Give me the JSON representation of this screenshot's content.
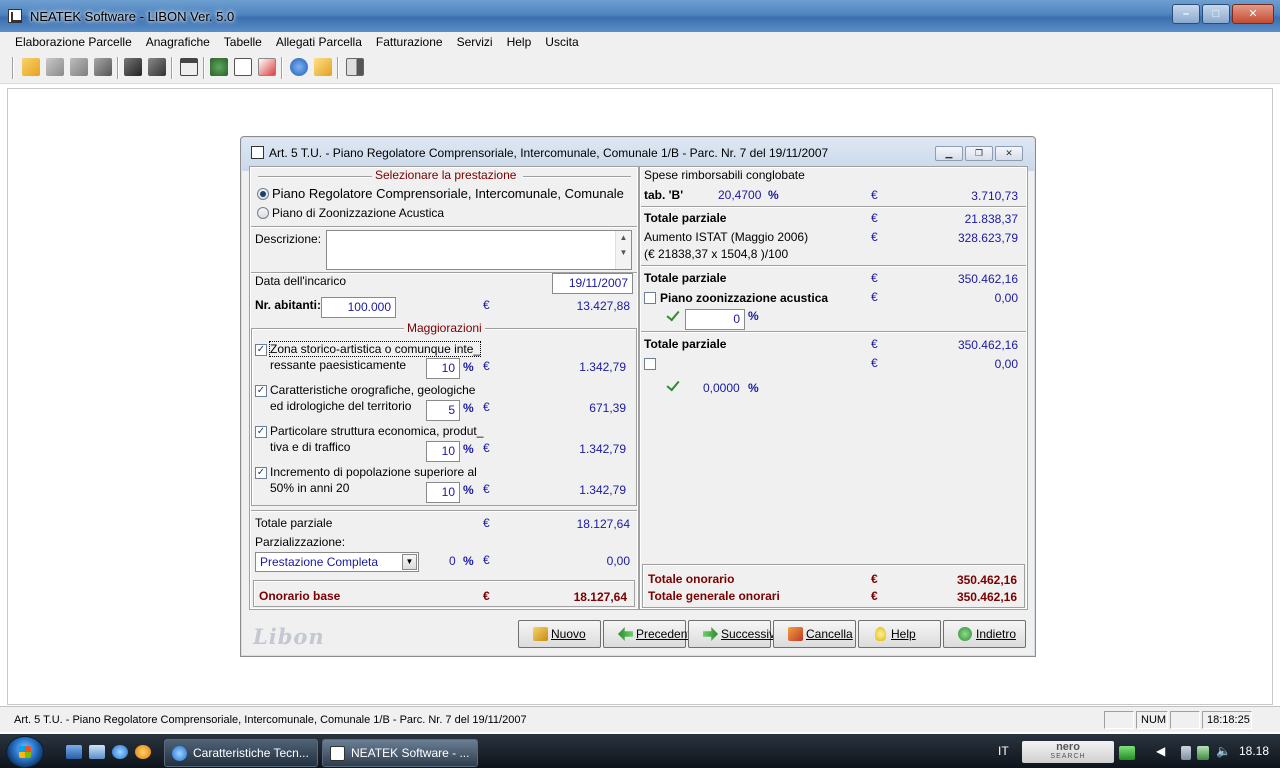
{
  "window": {
    "title": "NEATEK Software  -  LIBON Ver. 5.0"
  },
  "menu": [
    "Elaborazione Parcelle",
    "Anagrafiche",
    "Tabelle",
    "Allegati Parcella",
    "Fatturazione",
    "Servizi",
    "Help",
    "Uscita"
  ],
  "dialog": {
    "title": "Art. 5 T.U. - Piano Regolatore Comprensoriale, Intercomunale, Comunale 1/B - Parc. Nr. 7  del 19/11/2007",
    "left": {
      "select_header": "Selezionare la prestazione",
      "options": [
        {
          "label": "Piano Regolatore Comprensoriale, Intercomunale, Comunale",
          "selected": true
        },
        {
          "label": "Piano di Zoonizzazione Acustica",
          "selected": false
        }
      ],
      "descrizione_label": "Descrizione:",
      "descrizione_value": "",
      "data_label": "Data dell'incarico",
      "data_value": "19/11/2007",
      "abitanti_label": "Nr. abitanti:",
      "abitanti_value": "100.000",
      "abitanti_amount": "13.427,88",
      "maggiorazioni_header": "Maggiorazioni",
      "maggiorazioni": [
        {
          "line1": "Zona storico-artistica o comunque inte_",
          "line2": "ressante paesisticamente",
          "checked": true,
          "pct": "10",
          "amount": "1.342,79"
        },
        {
          "line1": "Caratteristiche orografiche, geologiche",
          "line2": "ed idrologiche del territorio",
          "checked": true,
          "pct": "5",
          "amount": "671,39"
        },
        {
          "line1": "Particolare struttura economica, produt_",
          "line2": "tiva e di traffico",
          "checked": true,
          "pct": "10",
          "amount": "1.342,79"
        },
        {
          "line1": "Incremento di popolazione superiore al",
          "line2": "50% in anni 20",
          "checked": true,
          "pct": "10",
          "amount": "1.342,79"
        }
      ],
      "totale_parziale_label": "Totale parziale",
      "totale_parziale_value": "18.127,64",
      "parzializzazione_label": "Parzializzazione:",
      "parzializzazione_select": "Prestazione Completa",
      "parzializzazione_pct": "0",
      "parzializzazione_value": "0,00",
      "onorario_base_label": "Onorario base",
      "onorario_base_value": "18.127,64"
    },
    "right": {
      "spese_label": "Spese rimborsabili conglobate",
      "tab_label": "tab. 'B'",
      "tab_pct": "20,4700",
      "tab_value": "3.710,73",
      "tp1_label": "Totale parziale",
      "tp1_value": "21.838,37",
      "istat_label": "Aumento ISTAT (Maggio 2006)",
      "istat_formula": "(€ 21838,37 x 1504,8 )/100",
      "istat_value": "328.623,79",
      "tp2_label": "Totale parziale",
      "tp2_value": "350.462,16",
      "zoon_label": "Piano zoonizzazione acustica",
      "zoon_value": "0,00",
      "zoon_pct": "0",
      "tp3_label": "Totale parziale",
      "tp3_value": "350.462,16",
      "extra_value": "0,00",
      "extra_pct": "0,0000",
      "totale_onorario_label": "Totale onorario",
      "totale_onorario_value": "350.462,16",
      "totale_generale_label": "Totale generale onorari",
      "totale_generale_value": "350.462,16"
    },
    "symbols": {
      "euro": "€",
      "percent": "%"
    },
    "logo": "Libon",
    "buttons": [
      "Nuovo",
      "Precedente",
      "Successivo",
      "Cancella",
      "Help",
      "Indietro"
    ]
  },
  "statusbar": {
    "text": "Art. 5 T.U. - Piano Regolatore Comprensoriale, Intercomunale, Comunale 1/B - Parc. Nr. 7  del 19/11/2007",
    "num": "NUM",
    "time": "18:18:25"
  },
  "taskbar": {
    "buttons": [
      "Caratteristiche Tecn...",
      "NEATEK Software  - ..."
    ],
    "lang": "IT",
    "nero_top": "nero",
    "nero_bottom": "SEARCH",
    "clock": "18.18"
  }
}
